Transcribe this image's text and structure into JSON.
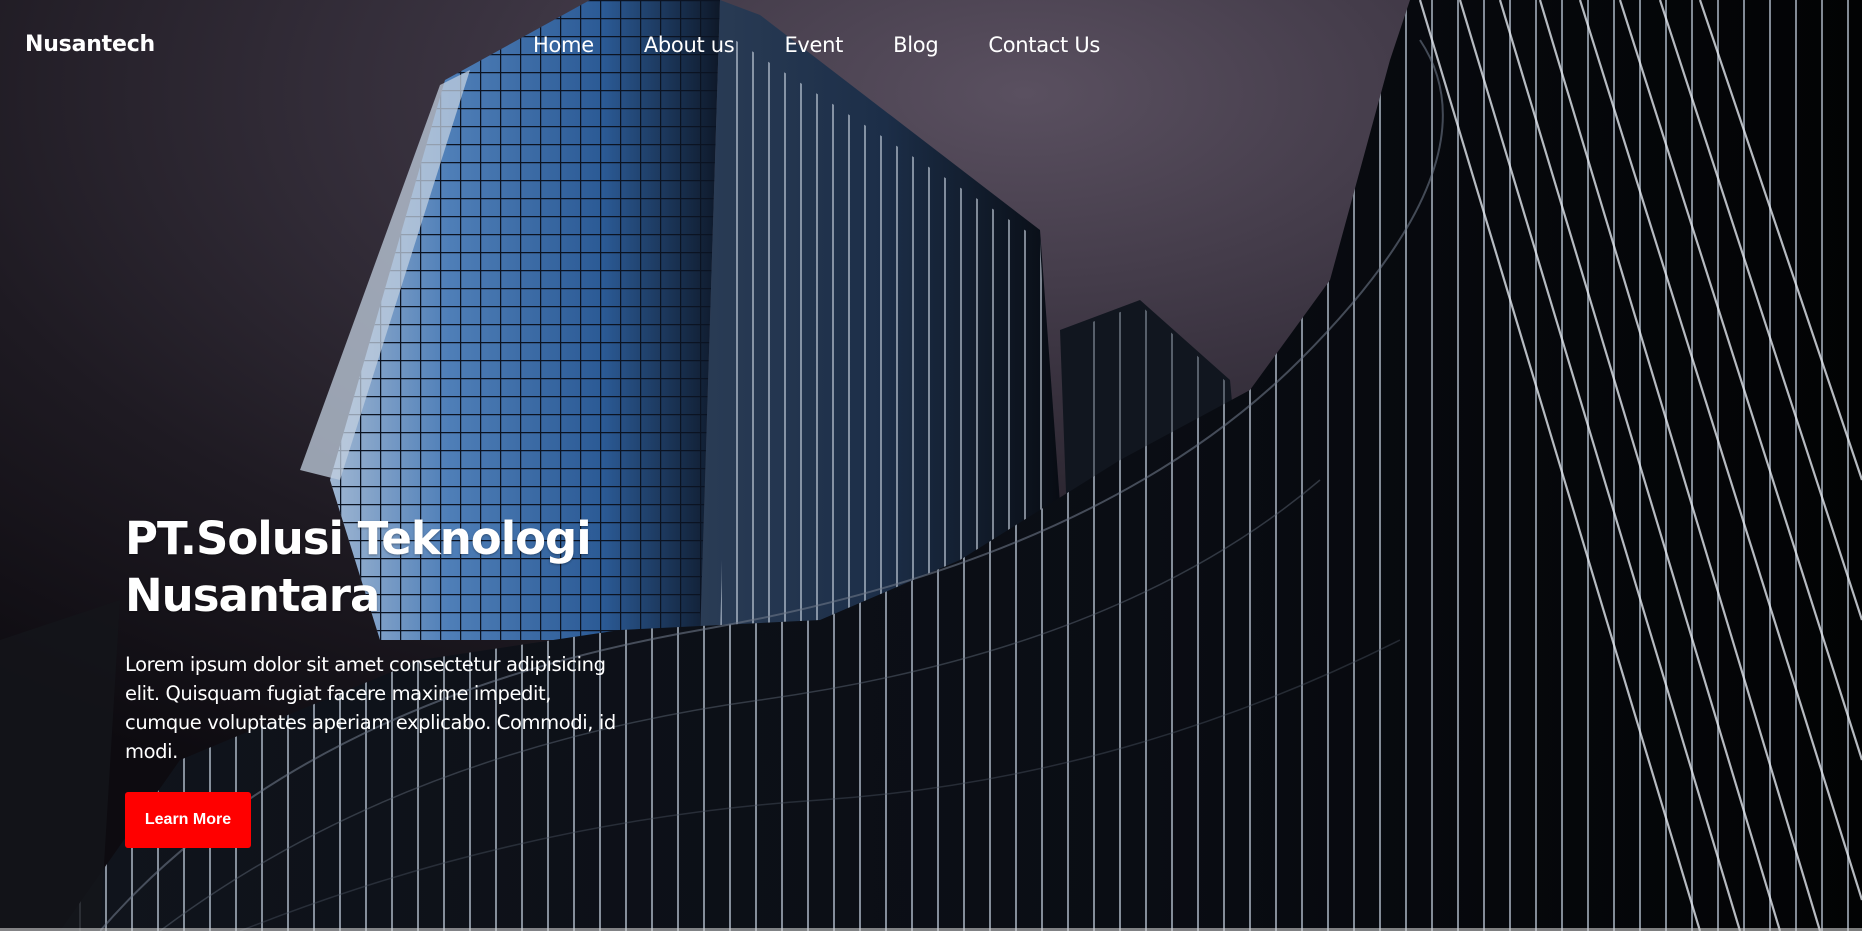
{
  "nav": {
    "brand": "Nusantech",
    "links": [
      "Home",
      "About us",
      "Event",
      "Blog",
      "Contact Us"
    ]
  },
  "hero": {
    "title_line1": "PT.Solusi Teknologi",
    "title_line2": "Nusantara",
    "description": "Lorem ipsum dolor sit amet consectetur adipisicing elit. Quisquam fugiat facere maxime impedit, cumque voluptates aperiam explicabo. Commodi, id modi.",
    "button_label": "Learn More"
  },
  "colors": {
    "button_bg": "#ff0000",
    "text": "#ffffff",
    "sky": "#2a2430",
    "glass_blue": "#3d6da8"
  }
}
